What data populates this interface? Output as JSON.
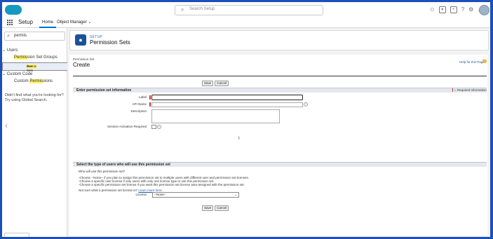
{
  "header": {
    "search_placeholder": "Search Setup",
    "icons": [
      "star-icon",
      "add-icon",
      "help-icon",
      "gear-icon",
      "bell-icon",
      "avatar"
    ]
  },
  "nav": {
    "app_name": "Setup",
    "tabs": [
      {
        "label": "Home",
        "active": true
      },
      {
        "label": "Object Manager",
        "active": false
      }
    ]
  },
  "sidebar": {
    "quick_find_value": "permis",
    "group_users": "Users",
    "item_psg_pre": "",
    "item_psg_hl": "Permis",
    "item_psg_post": "sion Set Groups",
    "item_ps_hl": "Permis",
    "item_ps_post": "sion Sets",
    "group_custom_code": "Custom Code",
    "item_cp_pre": "Custom ",
    "item_cp_hl": "Permis",
    "item_cp_post": "sions",
    "hint_line1": "Didn't find what you're looking for?",
    "hint_line2": "Try using Global Search."
  },
  "page_header": {
    "setup_label": "SETUP",
    "title": "Permission Sets"
  },
  "content": {
    "object_type": "Permission Set",
    "title": "Create",
    "help_link": "Help for this Page",
    "save_label": "Save",
    "cancel_label": "Cancel",
    "section1_title": "Enter permission set information",
    "required_info": "= Required Information",
    "label_label": "Label",
    "api_name_label": "API Name",
    "description_label": "Description",
    "session_activation_label": "Session Activation Required",
    "section2_title": "Select the type of users who will use this permission set",
    "who_question": "Who will use this permission set?",
    "choice1": "-Choose --None-- if you plan to assign this permission set to multiple users with different user and permission set licenses.",
    "choice2": "-Choose a specific user license if only users with only one license type to use this permission set.",
    "choice3": "-Choose a specific permission set license if you want this permission set license auto-assigned with the permission set.",
    "not_sure_text": "Not sure what a permission set license is?",
    "learn_more": "Learn more here.",
    "license_label": "License",
    "license_value": "--None--"
  }
}
